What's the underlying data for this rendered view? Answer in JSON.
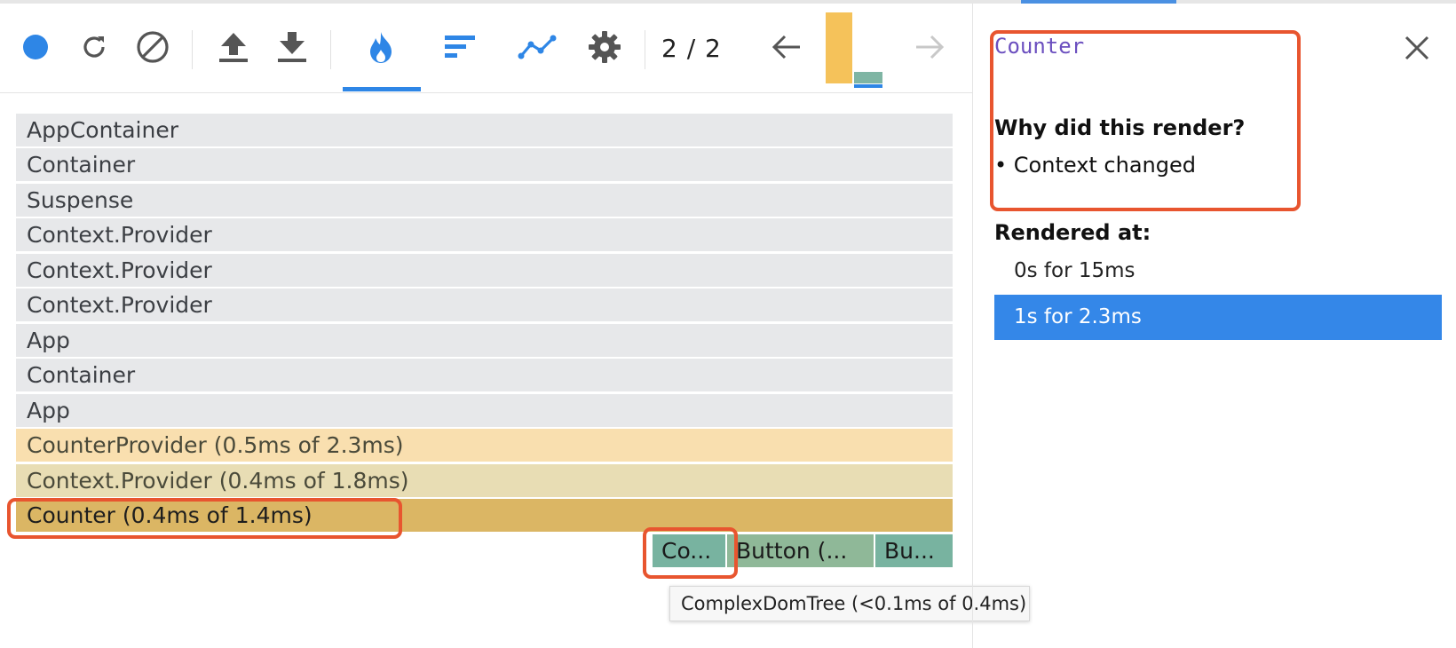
{
  "toolbar": {
    "icons": [
      "record-icon",
      "reload-icon",
      "clear-icon",
      "upload-icon",
      "download-icon",
      "flame-chart-icon",
      "ranked-chart-icon",
      "interactions-icon",
      "settings-icon",
      "previous-arrow-icon",
      "next-arrow-icon"
    ],
    "commit_counter": "2 / 2",
    "colors": {
      "accent": "#2e86e6",
      "commit_bar_1": "#f5c25a",
      "commit_bar_2": "#7fb5a4"
    }
  },
  "flamegraph": {
    "rows": [
      {
        "label": "AppContainer"
      },
      {
        "label": "Container"
      },
      {
        "label": "Suspense"
      },
      {
        "label": "Context.Provider"
      },
      {
        "label": "Context.Provider"
      },
      {
        "label": "Context.Provider"
      },
      {
        "label": "App"
      },
      {
        "label": "Container"
      },
      {
        "label": "App"
      },
      {
        "label": "CounterProvider (0.5ms of 2.3ms)"
      },
      {
        "label": "Context.Provider (0.4ms of 1.8ms)"
      },
      {
        "label": "Counter (0.4ms of 1.4ms)"
      }
    ],
    "children": [
      {
        "label": "Co..."
      },
      {
        "label": "Button (..."
      },
      {
        "label": "Bu..."
      }
    ],
    "tooltip": "ComplexDomTree (<0.1ms of 0.4ms)"
  },
  "panel": {
    "title": "Counter",
    "why_heading": "Why did this render?",
    "reason": "• Context changed",
    "rendered_heading": "Rendered at:",
    "renders": [
      {
        "label": "0s for 15ms"
      },
      {
        "label": "1s for 2.3ms"
      }
    ],
    "selected_render": 1
  },
  "colors": {
    "highlight": "#e8552f",
    "selected_row": "#3487e8",
    "title": "#6b4fbf"
  }
}
